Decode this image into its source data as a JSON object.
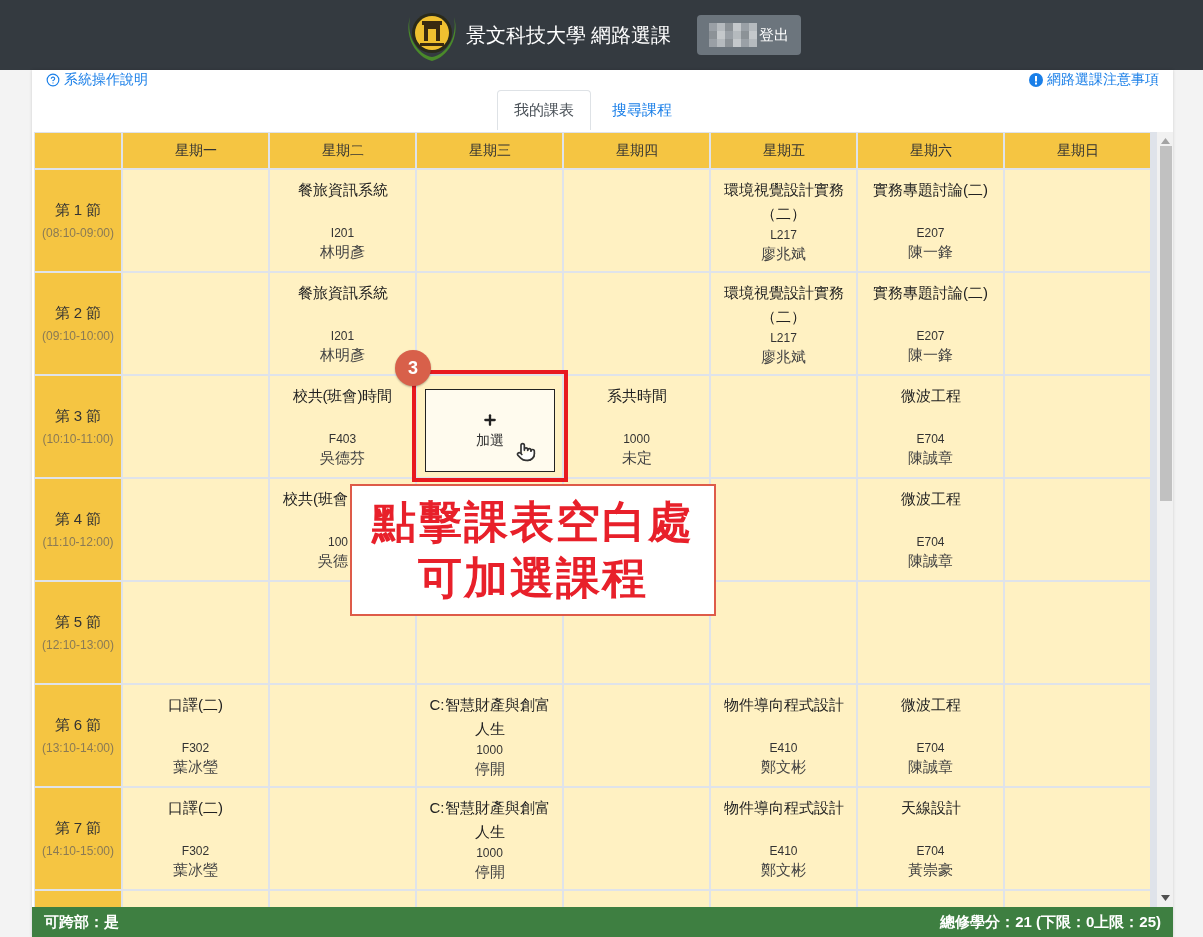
{
  "header": {
    "title": "景文科技大學 網路選課",
    "logout_button": "登出"
  },
  "links": {
    "help": "系統操作說明",
    "notice": "網路選課注意事項"
  },
  "tabs": [
    {
      "label": "我的課表",
      "selected": true
    },
    {
      "label": "搜尋課程",
      "selected": false
    }
  ],
  "timetable": {
    "days": [
      "星期一",
      "星期二",
      "星期三",
      "星期四",
      "星期五",
      "星期六",
      "星期日"
    ],
    "periods": [
      {
        "label": "第 1 節",
        "time": "(08:10-09:00)",
        "cells": [
          {
            "kind": "empty"
          },
          {
            "kind": "course",
            "title": "餐旅資訊系統",
            "room": "I201",
            "teacher": "林明彥"
          },
          {
            "kind": "empty"
          },
          {
            "kind": "empty"
          },
          {
            "kind": "course",
            "title": "環境視覺設計實務（二）",
            "room": "L217",
            "teacher": "廖兆斌"
          },
          {
            "kind": "course",
            "title": "實務專題討論(二)",
            "room": "E207",
            "teacher": "陳一鋒"
          },
          {
            "kind": "empty"
          }
        ]
      },
      {
        "label": "第 2 節",
        "time": "(09:10-10:00)",
        "cells": [
          {
            "kind": "empty"
          },
          {
            "kind": "course",
            "title": "餐旅資訊系統",
            "room": "I201",
            "teacher": "林明彥"
          },
          {
            "kind": "empty"
          },
          {
            "kind": "empty"
          },
          {
            "kind": "course",
            "title": "環境視覺設計實務（二）",
            "room": "L217",
            "teacher": "廖兆斌"
          },
          {
            "kind": "course",
            "title": "實務專題討論(二)",
            "room": "E207",
            "teacher": "陳一鋒"
          },
          {
            "kind": "empty"
          }
        ]
      },
      {
        "label": "第 3 節",
        "time": "(10:10-11:00)",
        "cells": [
          {
            "kind": "empty"
          },
          {
            "kind": "course",
            "title": "校共(班會)時間",
            "room": "F403",
            "teacher": "吳德芬"
          },
          {
            "kind": "add",
            "label": "加選"
          },
          {
            "kind": "course",
            "title": "系共時間",
            "room": "1000",
            "teacher": "未定"
          },
          {
            "kind": "empty"
          },
          {
            "kind": "course",
            "title": "微波工程",
            "room": "E704",
            "teacher": "陳誠章"
          },
          {
            "kind": "empty"
          }
        ]
      },
      {
        "label": "第 4 節",
        "time": "(11:10-12:00)",
        "cells": [
          {
            "kind": "empty"
          },
          {
            "kind": "cut",
            "title": "校共(班會",
            "room": "100",
            "teacher": "吳德"
          },
          {
            "kind": "empty"
          },
          {
            "kind": "empty"
          },
          {
            "kind": "empty"
          },
          {
            "kind": "course",
            "title": "微波工程",
            "room": "E704",
            "teacher": "陳誠章"
          },
          {
            "kind": "empty"
          }
        ]
      },
      {
        "label": "第 5 節",
        "time": "(12:10-13:00)",
        "cells": [
          {
            "kind": "empty"
          },
          {
            "kind": "empty"
          },
          {
            "kind": "empty"
          },
          {
            "kind": "empty"
          },
          {
            "kind": "empty"
          },
          {
            "kind": "empty"
          },
          {
            "kind": "empty"
          }
        ]
      },
      {
        "label": "第 6 節",
        "time": "(13:10-14:00)",
        "cells": [
          {
            "kind": "course",
            "title": "口譯(二)",
            "room": "F302",
            "teacher": "葉冰瑩"
          },
          {
            "kind": "empty"
          },
          {
            "kind": "course",
            "title": "C:智慧財產與創富人生",
            "room": "1000",
            "teacher": "停開"
          },
          {
            "kind": "empty"
          },
          {
            "kind": "course",
            "title": "物件導向程式設計",
            "room": "E410",
            "teacher": "鄭文彬"
          },
          {
            "kind": "course",
            "title": "微波工程",
            "room": "E704",
            "teacher": "陳誠章"
          },
          {
            "kind": "empty"
          }
        ]
      },
      {
        "label": "第 7 節",
        "time": "(14:10-15:00)",
        "cells": [
          {
            "kind": "course",
            "title": "口譯(二)",
            "room": "F302",
            "teacher": "葉冰瑩"
          },
          {
            "kind": "empty"
          },
          {
            "kind": "course",
            "title": "C:智慧財產與創富人生",
            "room": "1000",
            "teacher": "停開"
          },
          {
            "kind": "empty"
          },
          {
            "kind": "course",
            "title": "物件導向程式設計",
            "room": "E410",
            "teacher": "鄭文彬"
          },
          {
            "kind": "course",
            "title": "天線設計",
            "room": "E704",
            "teacher": "黃崇豪"
          },
          {
            "kind": "empty"
          }
        ]
      },
      {
        "cells": [
          {
            "kind": "empty"
          },
          {
            "kind": "empty"
          },
          {
            "kind": "empty"
          },
          {
            "kind": "empty"
          },
          {
            "kind": "empty"
          },
          {
            "kind": "empty"
          },
          {
            "kind": "empty"
          }
        ]
      }
    ]
  },
  "footer": {
    "left": "可跨部：是",
    "right": "總修學分：21 (下限：0上限：25)"
  },
  "callout": {
    "step": "3",
    "text_lines": [
      "點擊課表空白處",
      "可加選課程"
    ]
  }
}
